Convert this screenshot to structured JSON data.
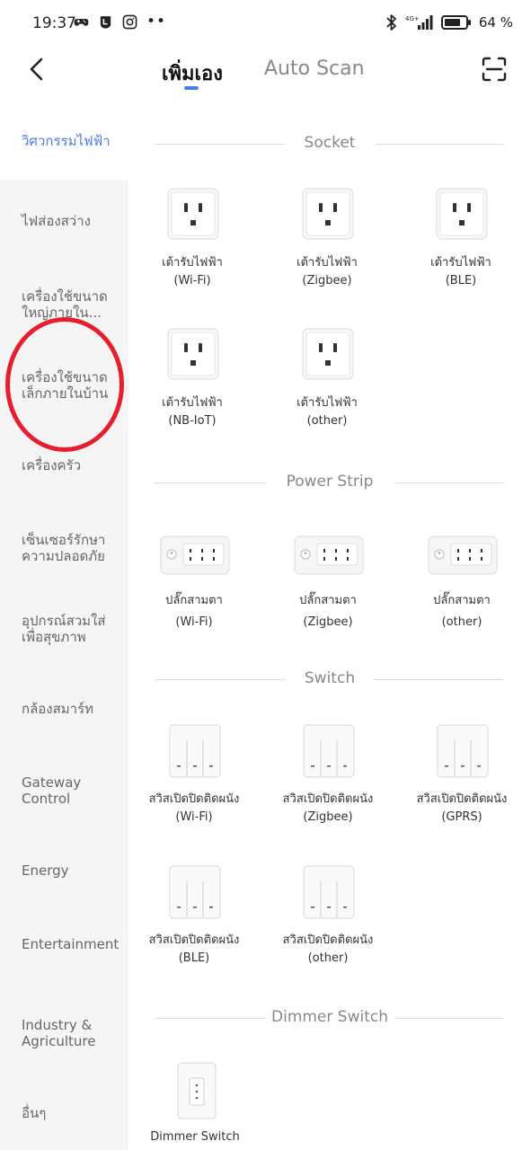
{
  "status_bar": {
    "time": "19:37",
    "icons_left": [
      "gamepad-icon",
      "line-icon",
      "instagram-icon"
    ],
    "dots": "••",
    "network": "4G+",
    "battery_pct": "64 %"
  },
  "header": {
    "tabs": [
      {
        "label": "เพิ่มเอง",
        "active": true
      },
      {
        "label": "Auto Scan",
        "active": false
      }
    ],
    "accent": "#4a7de8"
  },
  "sidebar": {
    "items": [
      {
        "label": "วิศวกรรมไฟฟ้า",
        "active": true
      },
      {
        "label": "ไฟส่องสว่าง"
      },
      {
        "label": "เครื่องใช้ขนาดใหญ่ภายใน..."
      },
      {
        "label": "เครื่องใช้ขนาดเล็กภายในบ้าน"
      },
      {
        "label": "เครื่องครัว"
      },
      {
        "label": "เซ็นเซอร์รักษาความปลอดภัย"
      },
      {
        "label": "อุปกรณ์สวมใส่เพื่อสุขภาพ"
      },
      {
        "label": "กล้องสมาร์ท"
      },
      {
        "label": "Gateway Control"
      },
      {
        "label": "Energy"
      },
      {
        "label": "Entertainment"
      },
      {
        "label": "Industry & Agriculture"
      },
      {
        "label": "อื่นๆ"
      }
    ],
    "highlight_color": "#e61f2e"
  },
  "sections": [
    {
      "title": "Socket",
      "devices": [
        {
          "name": "เต้ารับไฟฟ้า",
          "protocol": "(Wi-Fi)"
        },
        {
          "name": "เต้ารับไฟฟ้า",
          "protocol": "(Zigbee)"
        },
        {
          "name": "เต้ารับไฟฟ้า",
          "protocol": "(BLE)"
        },
        {
          "name": "เต้ารับไฟฟ้า",
          "protocol": "(NB-IoT)"
        },
        {
          "name": "เต้ารับไฟฟ้า",
          "protocol": "(other)"
        }
      ]
    },
    {
      "title": "Power Strip",
      "devices": [
        {
          "name": "ปลั๊กสามตา",
          "protocol": "(Wi-Fi)"
        },
        {
          "name": "ปลั๊กสามตา",
          "protocol": "(Zigbee)"
        },
        {
          "name": "ปลั๊กสามตา",
          "protocol": "(other)"
        }
      ]
    },
    {
      "title": "Switch",
      "devices": [
        {
          "name": "สวิสเปิดปิดติดผนัง",
          "protocol": "(Wi-Fi)"
        },
        {
          "name": "สวิสเปิดปิดติดผนัง",
          "protocol": "(Zigbee)"
        },
        {
          "name": "สวิสเปิดปิดติดผนัง",
          "protocol": "(GPRS)"
        },
        {
          "name": "สวิสเปิดปิดติดผนัง",
          "protocol": "(BLE)"
        },
        {
          "name": "สวิสเปิดปิดติดผนัง",
          "protocol": "(other)"
        }
      ]
    },
    {
      "title": "Dimmer Switch",
      "devices": [
        {
          "name": "Dimmer Switch",
          "protocol": ""
        }
      ]
    }
  ]
}
